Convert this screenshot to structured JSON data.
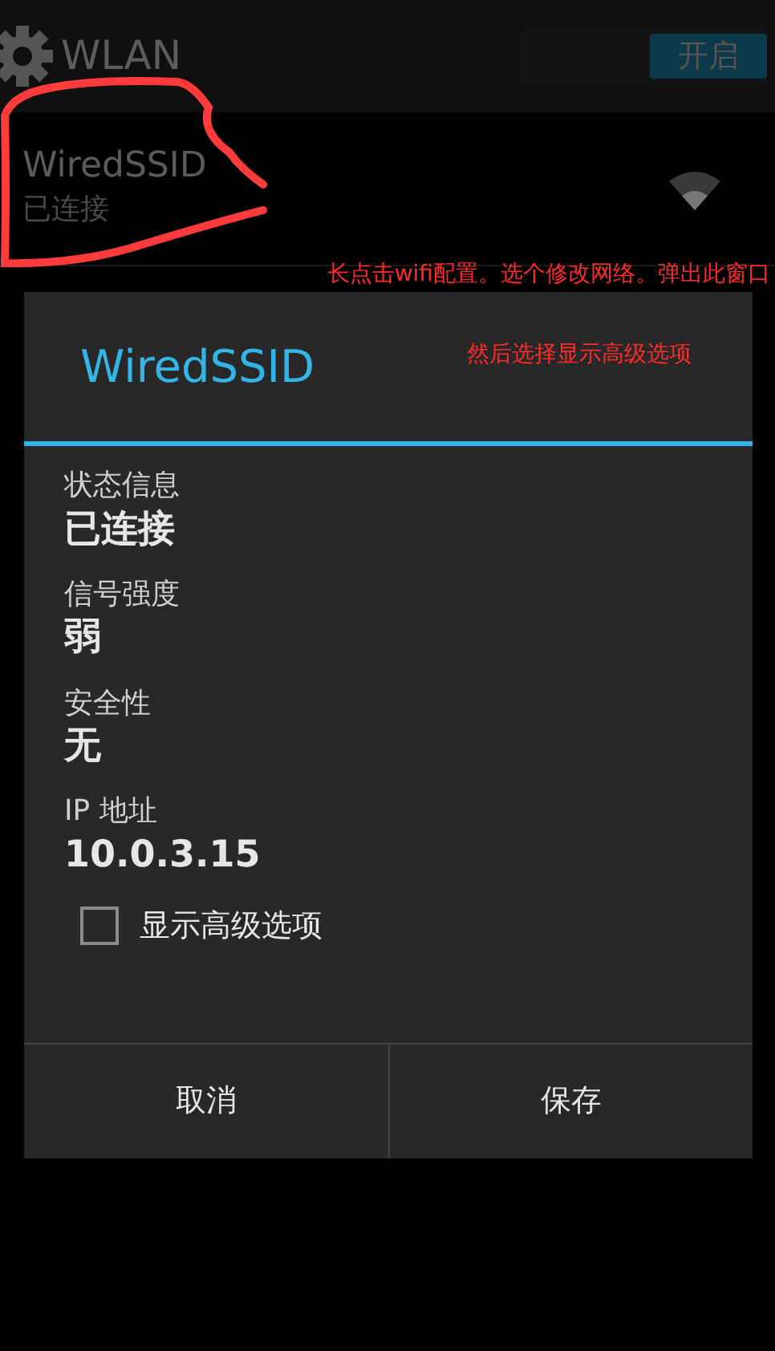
{
  "action_bar": {
    "title": "WLAN",
    "switch": {
      "label": "开启",
      "on": true
    }
  },
  "networks": [
    {
      "ssid": "WiredSSID",
      "status": "已连接"
    }
  ],
  "annotations": [
    {
      "kind": "circle"
    },
    {
      "kind": "note",
      "text": "长点击wifi配置。选个修改网络。弹出此窗口"
    },
    {
      "kind": "note",
      "text": "然后选择显示高级选项"
    }
  ],
  "dialog": {
    "title": "WiredSSID",
    "fields": [
      {
        "label": "状态信息",
        "value": "已连接"
      },
      {
        "label": "信号强度",
        "value": "弱"
      },
      {
        "label": "安全性",
        "value": "无"
      },
      {
        "label": "IP 地址",
        "value": "10.0.3.15"
      }
    ],
    "advanced": {
      "label": "显示高级选项",
      "checked": false
    },
    "buttons": [
      "取消",
      "保存"
    ]
  }
}
